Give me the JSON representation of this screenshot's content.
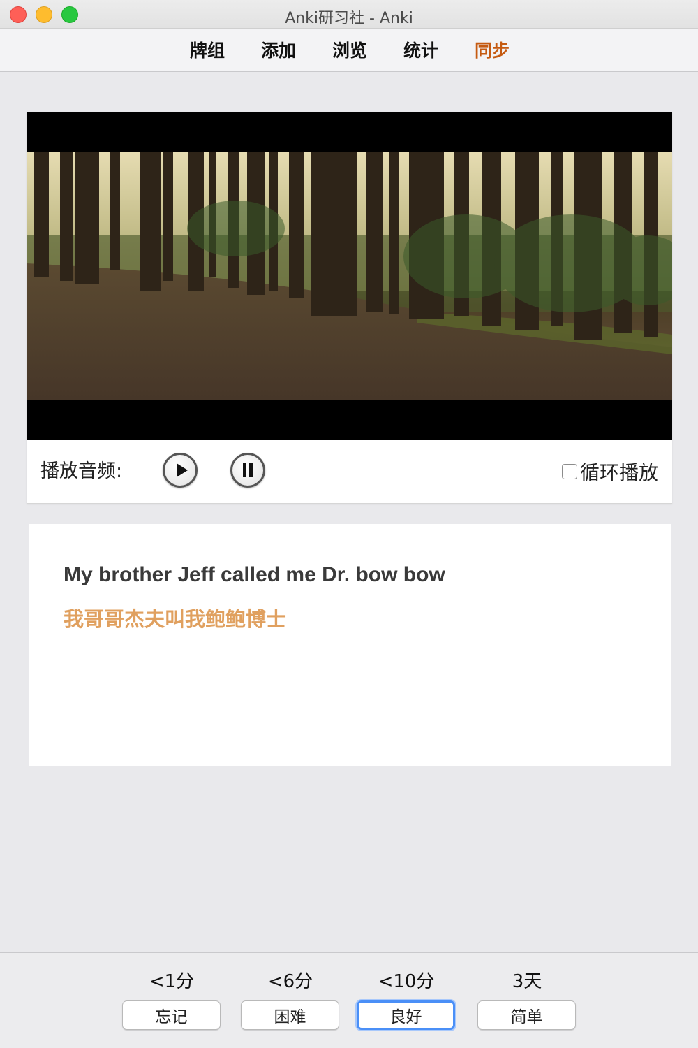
{
  "window": {
    "title": "Anki研习社 - Anki"
  },
  "nav": {
    "items": [
      {
        "label": "牌组"
      },
      {
        "label": "添加"
      },
      {
        "label": "浏览"
      },
      {
        "label": "统计"
      },
      {
        "label": "同步",
        "active": true
      }
    ],
    "active_color": "#c55a11"
  },
  "player": {
    "audio_label": "播放音频:",
    "play_icon": "play-icon",
    "pause_icon": "pause-icon",
    "loop_label": "循环播放",
    "loop_checked": false
  },
  "card": {
    "english": "My brother Jeff called me Dr. bow bow",
    "chinese": "我哥哥杰夫叫我鲍鲍博士",
    "chinese_color": "#e0a05f"
  },
  "answers": [
    {
      "interval": "<1分",
      "label": "忘记"
    },
    {
      "interval": "<6分",
      "label": "困难"
    },
    {
      "interval": "<10分",
      "label": "良好",
      "focused": true
    },
    {
      "interval": "3天",
      "label": "简单"
    }
  ],
  "colors": {
    "focus_ring": "#4a8ff7",
    "traffic_red": "#fe5f57",
    "traffic_yellow": "#febc2e",
    "traffic_green": "#28c840"
  }
}
